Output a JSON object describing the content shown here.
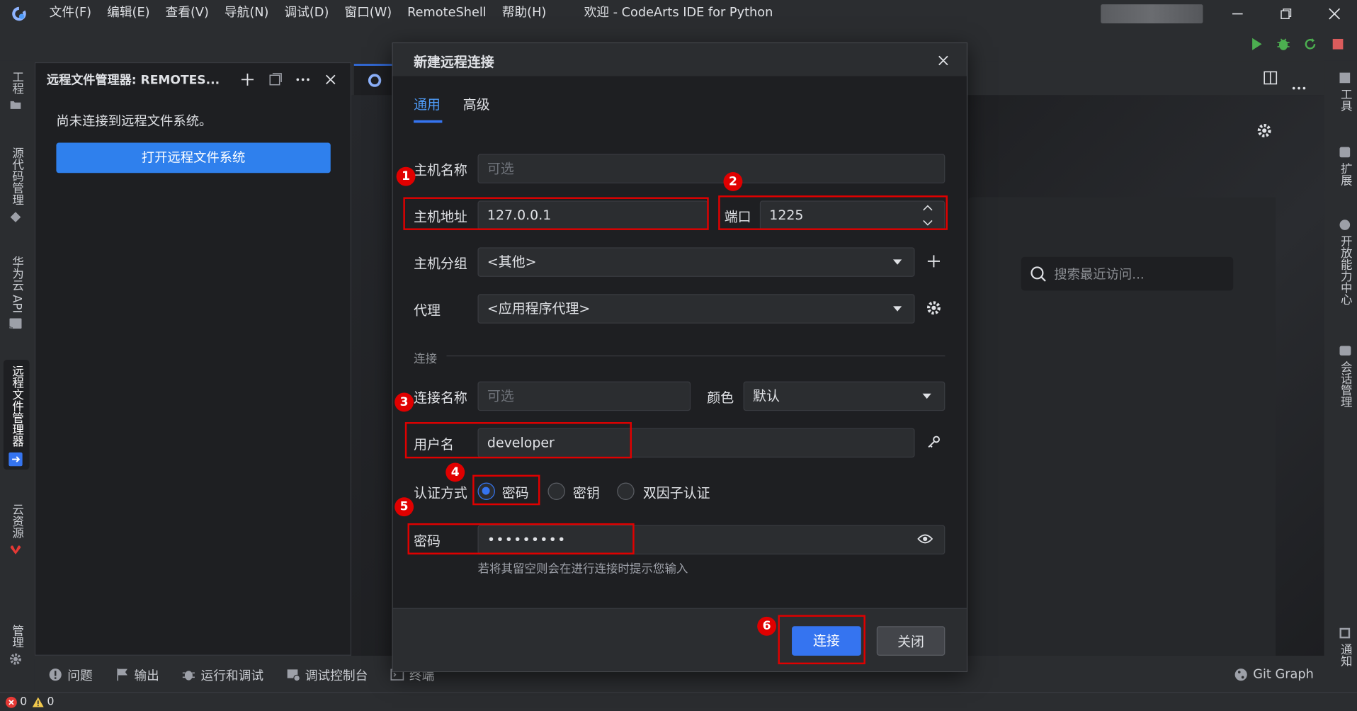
{
  "titlebar": {
    "menus": [
      "文件(F)",
      "编辑(E)",
      "查看(V)",
      "导航(N)",
      "调试(D)",
      "窗口(W)",
      "RemoteShell",
      "帮助(H)"
    ],
    "window_title": "欢迎 - CodeArts IDE for Python"
  },
  "left_bar": {
    "tabs": [
      "工程",
      "源代码管理",
      "华为云 API",
      "远程文件管理器",
      "云资源",
      "管理"
    ]
  },
  "right_bar": {
    "tabs": [
      "工具",
      "扩展",
      "开放能力中心",
      "会话管理",
      "通知"
    ]
  },
  "explorer": {
    "title": "远程文件管理器: REMOTES...",
    "message": "尚未连接到远程文件系统。",
    "open_button": "打开远程文件系统"
  },
  "welcome": {
    "search_placeholder": "搜索最近访问..."
  },
  "bottom_tabs": [
    "问题",
    "输出",
    "运行和调试",
    "调试控制台",
    "终端"
  ],
  "bottom_right": "Git Graph",
  "status": {
    "errors": "0",
    "warnings": "0"
  },
  "dialog": {
    "title": "新建远程连接",
    "tabs": [
      "通用",
      "高级"
    ],
    "host_name_label": "主机名称",
    "host_name_placeholder": "可选",
    "host_address_label": "主机地址",
    "host_address_value": "127.0.0.1",
    "port_label": "端口",
    "port_value": "1225",
    "host_group_label": "主机分组",
    "host_group_value": "<其他>",
    "proxy_label": "代理",
    "proxy_value": "<应用程序代理>",
    "section_connection": "连接",
    "connection_name_label": "连接名称",
    "connection_name_placeholder": "可选",
    "color_label": "颜色",
    "color_value": "默认",
    "username_label": "用户名",
    "username_value": "developer",
    "auth_label": "认证方式",
    "auth_options": [
      "密码",
      "密钥",
      "双因子认证"
    ],
    "auth_selected": "密码",
    "password_label": "密码",
    "password_value": "•••••••••",
    "password_hint": "若将其留空则会在进行连接时提示您输入",
    "connect_button": "连接",
    "close_button": "关闭"
  },
  "annotations": [
    "1",
    "2",
    "3",
    "4",
    "5",
    "6"
  ],
  "colors": {
    "accent": "#3574f0",
    "annotation_red": "#e00000",
    "run_green": "#4caf50",
    "stop_red": "#db5c5c"
  }
}
